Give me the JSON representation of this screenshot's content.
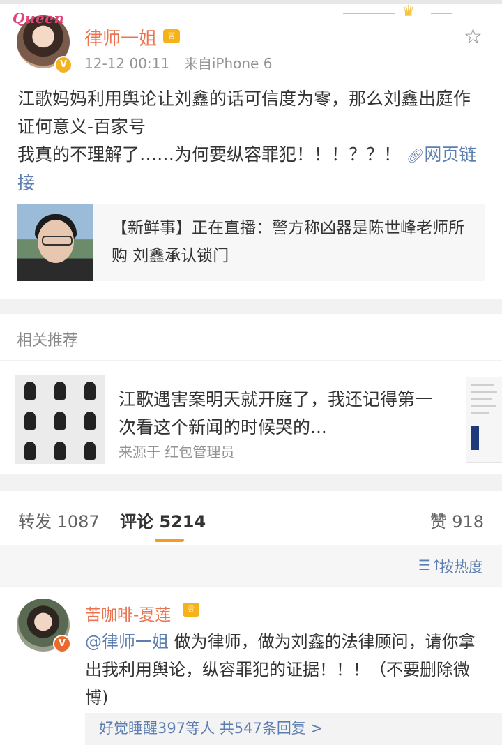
{
  "post": {
    "username": "律师一姐",
    "timestamp": "12-12 00:11",
    "source": "来自iPhone 6",
    "avatar_tag": "Queen",
    "content_line1": "江歌妈妈利用舆论让刘鑫的话可信度为零，那么刘鑫出庭作证何意义-百家号",
    "content_line2": "我真的不理解了……为何要纵容罪犯！！！？？！",
    "link_text": "网页链接",
    "share_card_text": "【新鲜事】正在直播：警方称凶器是陈世峰老师所购 刘鑫承认锁门"
  },
  "related": {
    "header": "相关推荐",
    "title": "江歌遇害案明天就开庭了，我还记得第一次看这个新闻的时候哭的...",
    "source": "来源于 红包管理员"
  },
  "tabs": {
    "repost": "转发 1087",
    "comment": "评论 5214",
    "like": "赞 918"
  },
  "sort": {
    "label": "按热度"
  },
  "comment": {
    "username": "苦咖啡-夏莲",
    "mention": "@律师一姐",
    "text": " 做为律师，做为刘鑫的法律顾问，请你拿出我利用舆论，纵容罪犯的证据！！！（不要删除微博)",
    "replies": "好觉睡醒397等人 共547条回复 >"
  },
  "colors": {
    "username": "#eb7350",
    "link": "#5d7eb0",
    "accent": "#f59a23",
    "verified": "#f6b21b"
  },
  "icons": [
    "star-icon",
    "link-icon",
    "crown-icon",
    "verified-icon",
    "sort-icon"
  ]
}
